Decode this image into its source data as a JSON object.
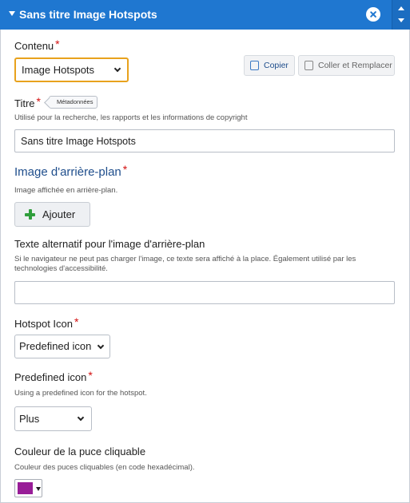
{
  "header": {
    "title": "Sans titre Image Hotspots"
  },
  "contenu": {
    "label": "Contenu",
    "required_mark": "*",
    "select_value": "Image Hotspots",
    "copy_label": "Copier",
    "paste_label": "Coller et Remplacer"
  },
  "titre": {
    "label": "Titre",
    "required_mark": "*",
    "metadata_label": "Métadonnées",
    "description": "Utilisé pour la recherche, les rapports et les informations de copyright",
    "value": "Sans titre Image Hotspots"
  },
  "background_image": {
    "label": "Image d'arrière-plan",
    "required_mark": "*",
    "description": "Image affichée en arrière-plan.",
    "add_label": "Ajouter"
  },
  "alt_text": {
    "label": "Texte alternatif pour l'image d'arrière-plan",
    "description_line1": "Si le navigateur ne peut pas charger l'image, ce texte sera affiché à la place. Également utilisé par les",
    "description_line2": "technologies d'accessibilité.",
    "value": ""
  },
  "hotspot_icon": {
    "label": "Hotspot Icon",
    "required_mark": "*",
    "select_value": "Predefined icon"
  },
  "predefined_icon": {
    "label": "Predefined icon",
    "required_mark": "*",
    "description": "Using a predefined icon for the hotspot.",
    "select_value": "Plus"
  },
  "hotspot_color": {
    "label": "Couleur de la puce cliquable",
    "description": "Couleur des puces cliquables (en code hexadécimal).",
    "value_color": "#981d97"
  },
  "colors": {
    "header": "#1f77d0",
    "required": "#d30f0f",
    "section_title": "#1f4e8c",
    "focus_border": "#e8a21d",
    "add_icon": "#2f9e3b"
  }
}
